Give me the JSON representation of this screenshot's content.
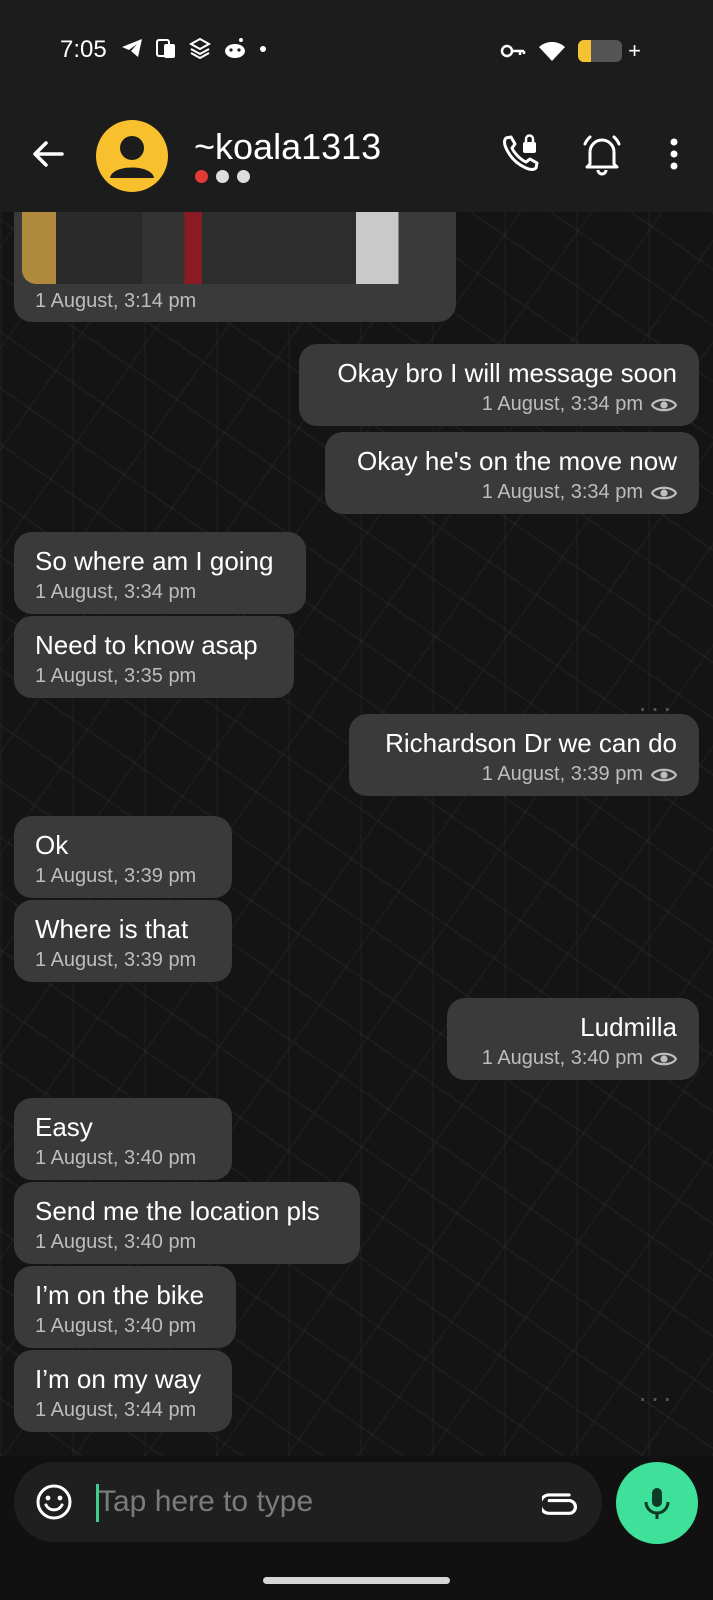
{
  "status_bar": {
    "time": "7:05"
  },
  "header": {
    "contact_name": "~koala1313"
  },
  "photo_message": {
    "time": "1 August, 3:14 pm"
  },
  "messages": [
    {
      "dir": "out",
      "text": "Okay bro I will message soon",
      "time": "1 August, 3:34 pm"
    },
    {
      "dir": "out",
      "text": "Okay he's on the move now",
      "time": "1 August, 3:34 pm"
    },
    {
      "dir": "in",
      "text": "So where am I going",
      "time": "1 August, 3:34 pm"
    },
    {
      "dir": "in",
      "text": "Need to know asap",
      "time": "1 August, 3:35 pm"
    },
    {
      "dir": "out",
      "text": "Richardson Dr we can do",
      "time": "1 August, 3:39 pm"
    },
    {
      "dir": "in",
      "text": "Ok",
      "time": "1 August, 3:39 pm"
    },
    {
      "dir": "in",
      "text": "Where is that",
      "time": "1 August, 3:39 pm"
    },
    {
      "dir": "out",
      "text": "Ludmilla",
      "time": "1 August, 3:40 pm"
    },
    {
      "dir": "in",
      "text": "Easy",
      "time": "1 August, 3:40 pm"
    },
    {
      "dir": "in",
      "text": "Send me the location pls",
      "time": "1 August, 3:40 pm"
    },
    {
      "dir": "in",
      "text": "I’m on the bike",
      "time": "1 August, 3:40 pm"
    },
    {
      "dir": "in",
      "text": "I’m on my way",
      "time": "1 August, 3:44 pm"
    }
  ],
  "composer": {
    "placeholder": "Tap here to type"
  },
  "icons": {
    "back": "arrow-left-icon",
    "avatar": "person-icon",
    "call": "phone-call-icon",
    "notify": "bell-icon",
    "menu": "more-vertical-icon",
    "emoji": "smiley-icon",
    "attach": "paperclip-icon",
    "mic": "microphone-icon",
    "seen": "eye-icon"
  },
  "colors": {
    "accent": "#3ee09a",
    "avatar": "#f9c02d",
    "bubble": "#3a3a3a",
    "header": "#1c1c1c"
  }
}
